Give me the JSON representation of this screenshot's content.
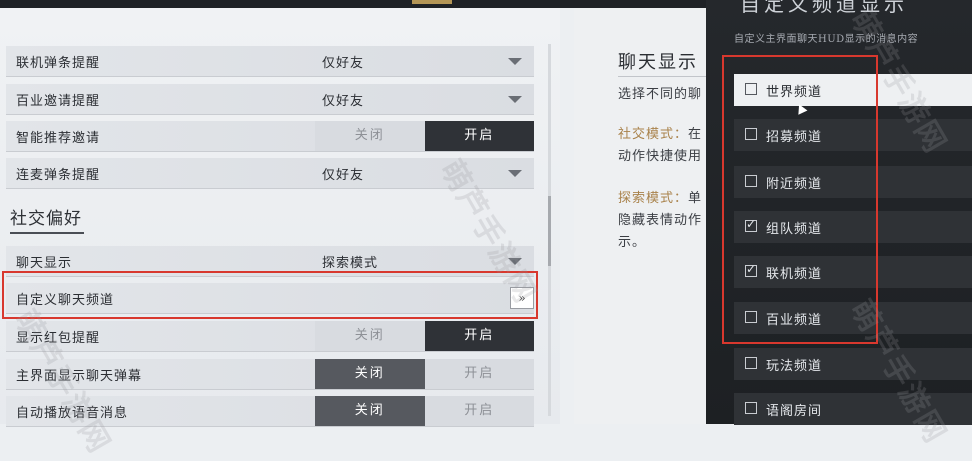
{
  "rows_top": [
    {
      "label": "联机弹条提醒",
      "value": "仅好友"
    },
    {
      "label": "百业邀请提醒",
      "value": "仅好友"
    },
    {
      "label": "智能推荐邀请",
      "toggle": {
        "off": "关闭",
        "on": "开启",
        "state": "on"
      }
    },
    {
      "label": "连麦弹条提醒",
      "value": "仅好友"
    }
  ],
  "section": {
    "title": "社交偏好"
  },
  "rows_social": [
    {
      "label": "聊天显示",
      "value": "探索模式"
    },
    {
      "label": "自定义聊天频道",
      "button": "»"
    },
    {
      "label": "显示红包提醒",
      "toggle": {
        "off": "关闭",
        "on": "开启",
        "state": "on"
      }
    },
    {
      "label": "主界面显示聊天弹幕",
      "toggle": {
        "off": "关闭",
        "on": "开启",
        "state": "off"
      }
    },
    {
      "label": "自动播放语音消息",
      "toggle": {
        "off": "关闭",
        "on": "开启",
        "state": "off"
      }
    }
  ],
  "description": {
    "title": "聊天显示",
    "intro": "选择不同的聊",
    "social_prefix": "社交模式：",
    "social_text": "在",
    "social_line2": "动作快捷使用",
    "explore_prefix": "探索模式：",
    "explore_text": "单",
    "explore_line2": "隐藏表情动作",
    "explore_line3": "示。"
  },
  "overlay": {
    "title": "自定义频道显示",
    "subtitle": "自定义主界面聊天HUD显示的消息内容",
    "channels": [
      {
        "label": "世界频道",
        "checked": false,
        "selected": true
      },
      {
        "label": "招募频道",
        "checked": false
      },
      {
        "label": "附近频道",
        "checked": false
      },
      {
        "label": "组队频道",
        "checked": true
      },
      {
        "label": "联机频道",
        "checked": true
      },
      {
        "label": "百业频道",
        "checked": false
      },
      {
        "label": "玩法频道",
        "checked": false
      },
      {
        "label": "语阁房间",
        "checked": false
      }
    ]
  },
  "watermark": "萌芦手游网",
  "colors": {
    "highlight": "#d8382e",
    "gold": "#a9824b",
    "dark_toggle": "#2f3237"
  }
}
